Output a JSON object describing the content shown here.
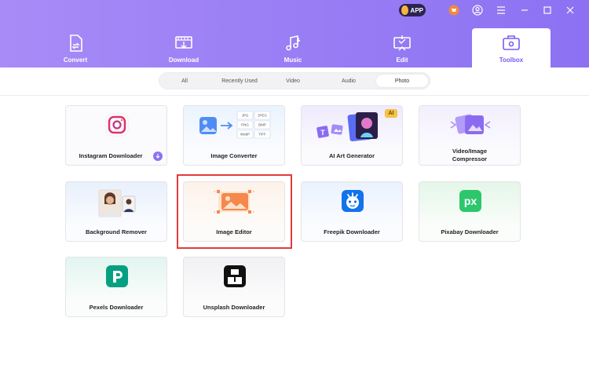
{
  "titlebar": {
    "app_badge": "APP",
    "icons": [
      "cart-icon",
      "account-icon",
      "menu-icon",
      "minimize-icon",
      "maximize-icon",
      "close-icon"
    ]
  },
  "tabs": [
    {
      "label": "Convert",
      "icon": "convert-icon"
    },
    {
      "label": "Download",
      "icon": "download-icon"
    },
    {
      "label": "Music",
      "icon": "music-icon"
    },
    {
      "label": "Edit",
      "icon": "edit-icon"
    },
    {
      "label": "Toolbox",
      "icon": "toolbox-icon",
      "active": true
    }
  ],
  "filters": [
    {
      "label": "All"
    },
    {
      "label": "Recently Used"
    },
    {
      "label": "Video"
    },
    {
      "label": "Audio"
    },
    {
      "label": "Photo",
      "active": true
    }
  ],
  "tools": [
    {
      "label": "Instagram Downloader"
    },
    {
      "label": "Image Converter",
      "formats": [
        "JPG",
        "JPEG",
        "PNG",
        "BMP",
        "WebP",
        "TIFF"
      ]
    },
    {
      "label": "AI Art Generator",
      "badge": "AI"
    },
    {
      "label": "Video/Image",
      "label2": "Compressor"
    },
    {
      "label": "Background Remover"
    },
    {
      "label": "Image Editor"
    },
    {
      "label": "Freepik Downloader"
    },
    {
      "label": "Pixabay Downloader",
      "logo_text": "px"
    },
    {
      "label": "Pexels Downloader"
    },
    {
      "label": "Unsplash Downloader"
    }
  ],
  "colors": {
    "accent": "#7b5cf0",
    "header_start": "#a98bf7",
    "header_end": "#8c72f2",
    "highlight": "#e23b3b"
  }
}
